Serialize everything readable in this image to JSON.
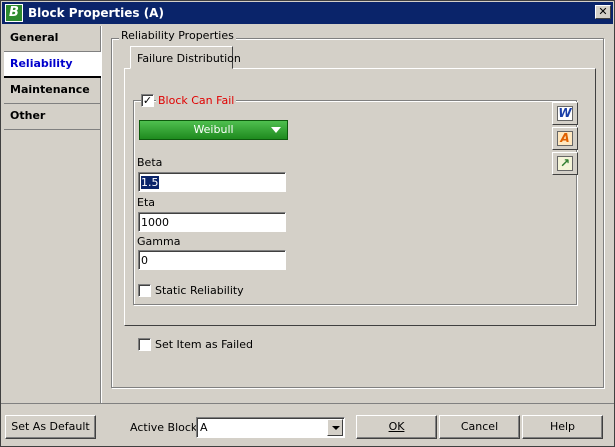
{
  "window": {
    "title": "Block Properties (A)",
    "app_icon": "B",
    "close": "✕"
  },
  "sidebar": {
    "items": [
      {
        "label": "General"
      },
      {
        "label": "Reliability"
      },
      {
        "label": "Maintenance"
      },
      {
        "label": "Other"
      }
    ],
    "active_index": 1
  },
  "panel": {
    "group_label": "Reliability Properties",
    "tab_label": "Failure Distribution",
    "block_can_fail": {
      "label": "Block Can Fail",
      "checked": true,
      "color": "#e00000"
    },
    "distribution": {
      "value": "Weibull",
      "color": "#2e9c2e"
    },
    "params": [
      {
        "label": "Beta",
        "value": "1.5",
        "selected": true
      },
      {
        "label": "Eta",
        "value": "1000"
      },
      {
        "label": "Gamma",
        "value": "0"
      }
    ],
    "static_reliability": {
      "label": "Static Reliability",
      "checked": false
    },
    "set_item_failed": {
      "label": "Set Item as Failed",
      "checked": false
    },
    "icons": [
      {
        "name": "weibull-w-icon",
        "glyph": "W"
      },
      {
        "name": "quick-param-a-icon",
        "glyph": "A"
      },
      {
        "name": "plot-icon",
        "glyph": "↗"
      }
    ]
  },
  "footer": {
    "set_default": "Set As Default",
    "active_block_label": "Active Block:",
    "active_block_value": "A",
    "ok": "OK",
    "cancel": "Cancel",
    "help": "Help"
  }
}
